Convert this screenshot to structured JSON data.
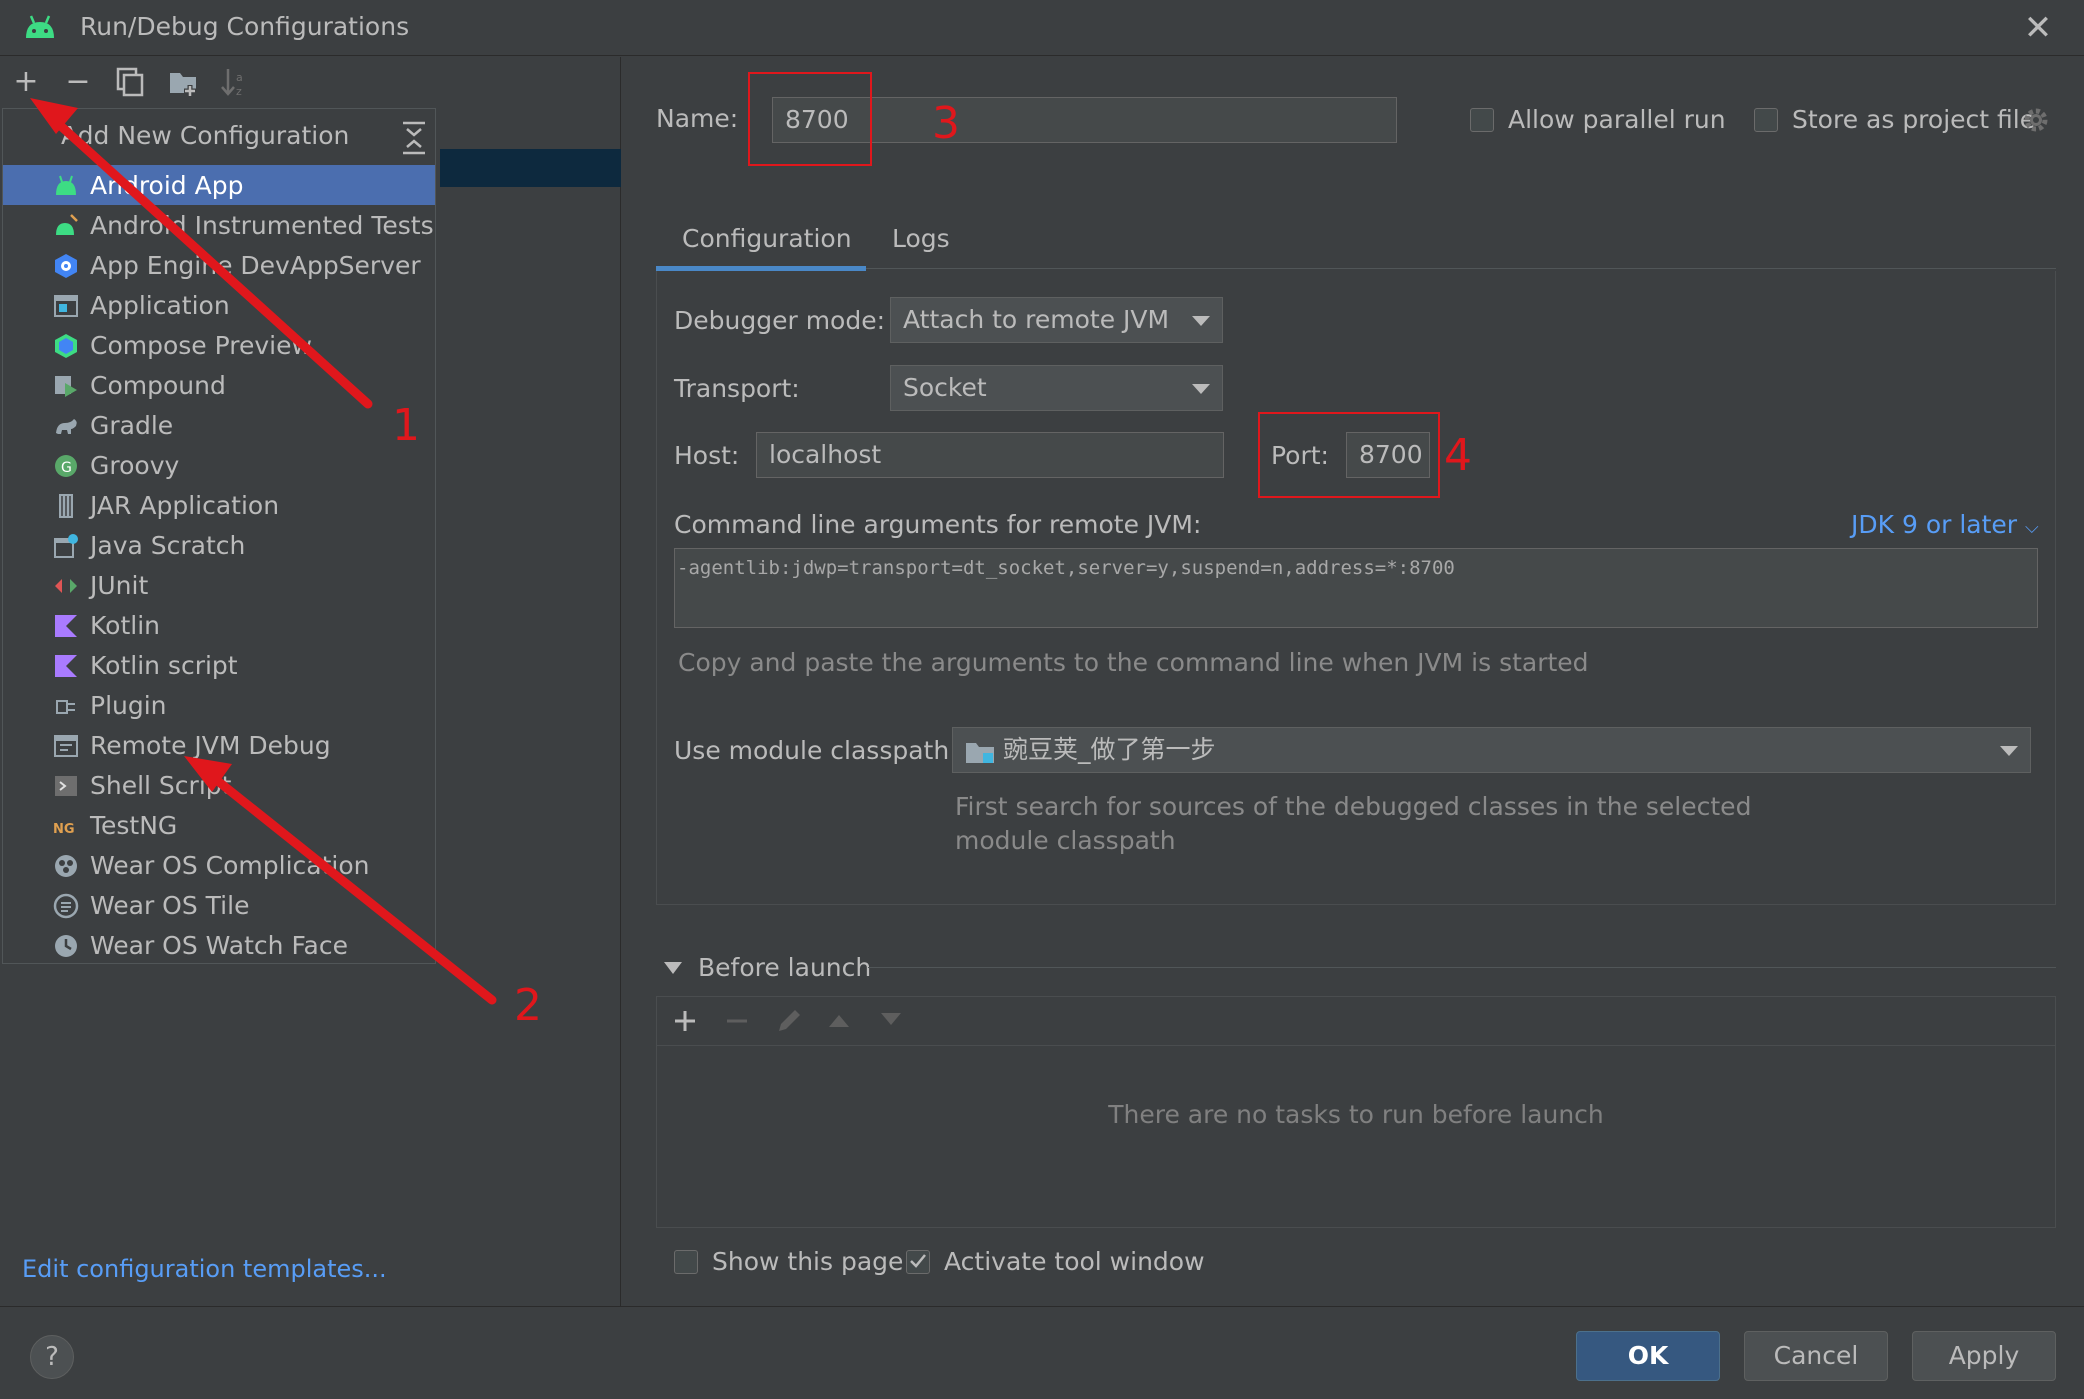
{
  "window": {
    "title": "Run/Debug Configurations",
    "close_glyph": "✕"
  },
  "left_toolbar": {
    "add": "+",
    "remove": "−",
    "copy": "❐",
    "folder": "▣",
    "sort": "↓ª"
  },
  "popup": {
    "title": "Add New Configuration",
    "items": [
      {
        "label": "Android App",
        "icon": "android-icon",
        "selected": true
      },
      {
        "label": "Android Instrumented Tests",
        "icon": "android-test-icon"
      },
      {
        "label": "App Engine DevAppServer",
        "icon": "app-engine-icon"
      },
      {
        "label": "Application",
        "icon": "application-icon"
      },
      {
        "label": "Compose Preview",
        "icon": "compose-icon"
      },
      {
        "label": "Compound",
        "icon": "compound-icon"
      },
      {
        "label": "Gradle",
        "icon": "gradle-icon"
      },
      {
        "label": "Groovy",
        "icon": "groovy-icon"
      },
      {
        "label": "JAR Application",
        "icon": "jar-icon"
      },
      {
        "label": "Java Scratch",
        "icon": "java-scratch-icon"
      },
      {
        "label": "JUnit",
        "icon": "junit-icon"
      },
      {
        "label": "Kotlin",
        "icon": "kotlin-icon"
      },
      {
        "label": "Kotlin script",
        "icon": "kotlin-script-icon"
      },
      {
        "label": "Plugin",
        "icon": "plugin-icon"
      },
      {
        "label": "Remote JVM Debug",
        "icon": "remote-debug-icon"
      },
      {
        "label": "Shell Script",
        "icon": "shell-icon"
      },
      {
        "label": "TestNG",
        "icon": "testng-icon"
      },
      {
        "label": "Wear OS Complication",
        "icon": "wear-complication-icon"
      },
      {
        "label": "Wear OS Tile",
        "icon": "wear-tile-icon"
      },
      {
        "label": "Wear OS Watch Face",
        "icon": "wear-watchface-icon"
      }
    ]
  },
  "edit_templates_link": "Edit configuration templates...",
  "config": {
    "name_label": "Name:",
    "name_value": "8700",
    "allow_parallel_label": "Allow parallel run",
    "store_project_label": "Store as project file",
    "tabs": [
      "Configuration",
      "Logs"
    ],
    "debugger_mode_label": "Debugger mode:",
    "debugger_mode_value": "Attach to remote JVM",
    "transport_label": "Transport:",
    "transport_value": "Socket",
    "host_label": "Host:",
    "host_value": "localhost",
    "port_label": "Port:",
    "port_value": "8700",
    "cmd_label": "Command line arguments for remote JVM:",
    "jdk_link": "JDK 9 or later",
    "cmd_value": "-agentlib:jdwp=transport=dt_socket,server=y,suspend=n,address=*:8700",
    "cmd_hint": "Copy and paste the arguments to the command line when JVM is started",
    "module_label": "Use module classpath:",
    "module_value": "豌豆荚_做了第一步",
    "module_hint_1": "First search for sources of the debugged classes in the selected",
    "module_hint_2": "module classpath"
  },
  "before_launch": {
    "title": "Before launch",
    "empty": "There are no tasks to run before launch",
    "show_page": "Show this page",
    "activate_tool": "Activate tool window"
  },
  "annotations": {
    "n1": "1",
    "n2": "2",
    "n3": "3",
    "n4": "4"
  },
  "buttons": {
    "help": "?",
    "ok": "OK",
    "cancel": "Cancel",
    "apply": "Apply"
  },
  "colors": {
    "accent": "#4b6eaf",
    "link": "#589df6",
    "annotation": "#e0171c",
    "primary_button": "#365880"
  }
}
